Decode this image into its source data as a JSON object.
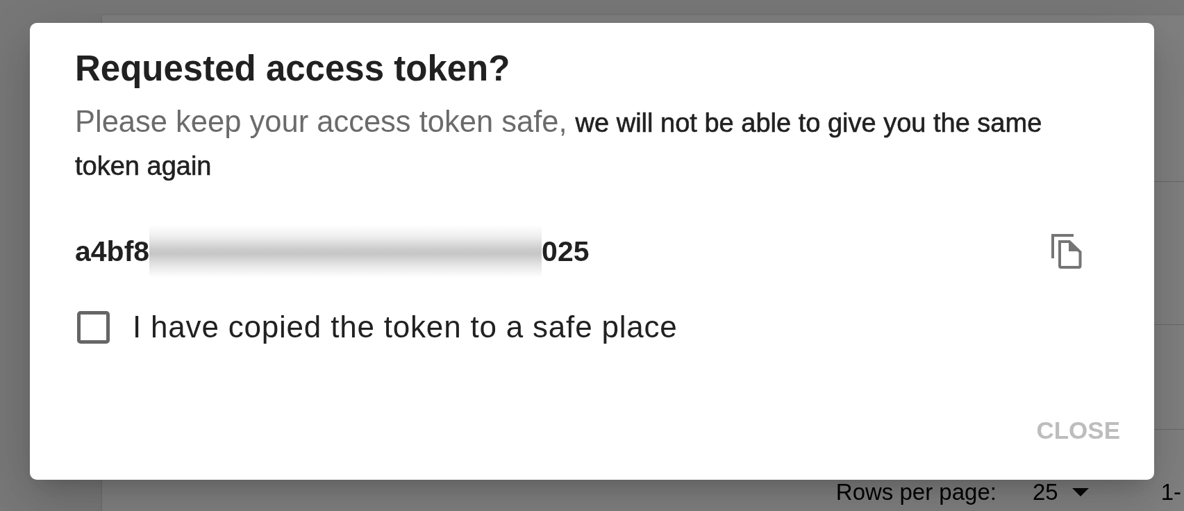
{
  "background": {
    "pagination": {
      "rows_per_page_label": "Rows per page:",
      "rows_per_page": "25",
      "range": "1-"
    }
  },
  "dialog": {
    "title": "Requested access token?",
    "message": "Please keep your access token safe, **we will not be able to give you the same token again**",
    "token": {
      "start": "a4bf8",
      "redacted": true,
      "end": "025"
    },
    "confirm": {
      "label": "I have copied the token to a safe place",
      "checked": false
    },
    "actions": [
      {
        "label": "CLOSE",
        "disabled": true
      }
    ]
  }
}
